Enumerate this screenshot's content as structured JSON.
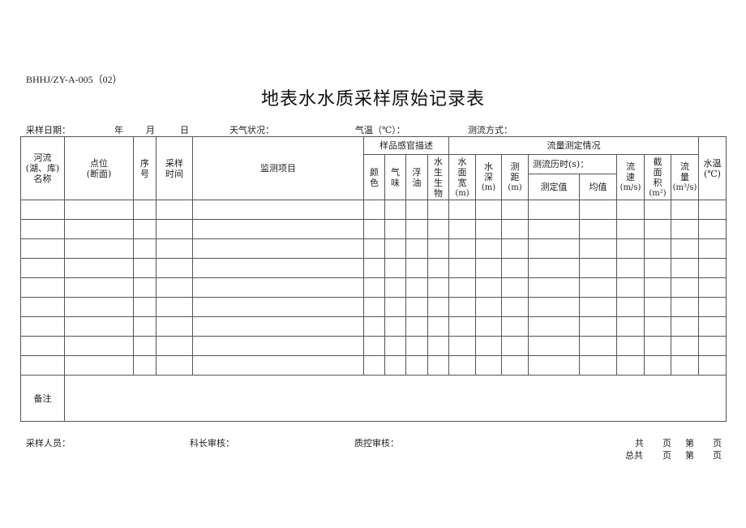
{
  "document": {
    "code": "BHHJ/ZY-A-005（02）",
    "title": "地表水水质采样原始记录表"
  },
  "meta": {
    "sampling_date_label": "采样日期：",
    "year": "年",
    "month": "月",
    "day": "日",
    "weather_label": "天气状况：",
    "air_temp_label": "气温（℃）：",
    "flow_method_label": "测流方式："
  },
  "table": {
    "headers": {
      "river_name": "河流(湖、库)名称",
      "river_name_lines": [
        "河流",
        "(湖、库)",
        "名称"
      ],
      "point_lines": [
        "点位",
        "(断面)"
      ],
      "seq_lines": [
        "序",
        "号"
      ],
      "time_lines": [
        "采样",
        "时间"
      ],
      "items": "监测项目",
      "sensory_group": "样品感官描述",
      "color": "颜色",
      "odor": "气味",
      "oil": "浮油",
      "organisms": "水生生物",
      "flow_group": "流量测定情况",
      "width": "水面宽",
      "width_unit": "(m)",
      "depth": "水深",
      "depth_unit": "(m)",
      "distance": "测距",
      "distance_unit": "(m)",
      "duration": "测流历时(s)：",
      "measured": "测定值",
      "average": "均值",
      "velocity": "流速",
      "velocity_unit": "(m/s)",
      "area": "截面积",
      "area_unit": "(m²)",
      "flow": "流量",
      "flow_unit": "(m³/s)",
      "water_temp_lines": [
        "水温",
        "(℃)"
      ]
    },
    "row_count": 9,
    "remark_label": "备注"
  },
  "footer": {
    "sampler_label": "采样人员：",
    "section_review_label": "科长审核：",
    "qc_review_label": "质控审核：",
    "page_line1": [
      "共",
      "页",
      "第",
      "页"
    ],
    "page_line2": [
      "总共",
      "页",
      "第",
      "页"
    ]
  }
}
